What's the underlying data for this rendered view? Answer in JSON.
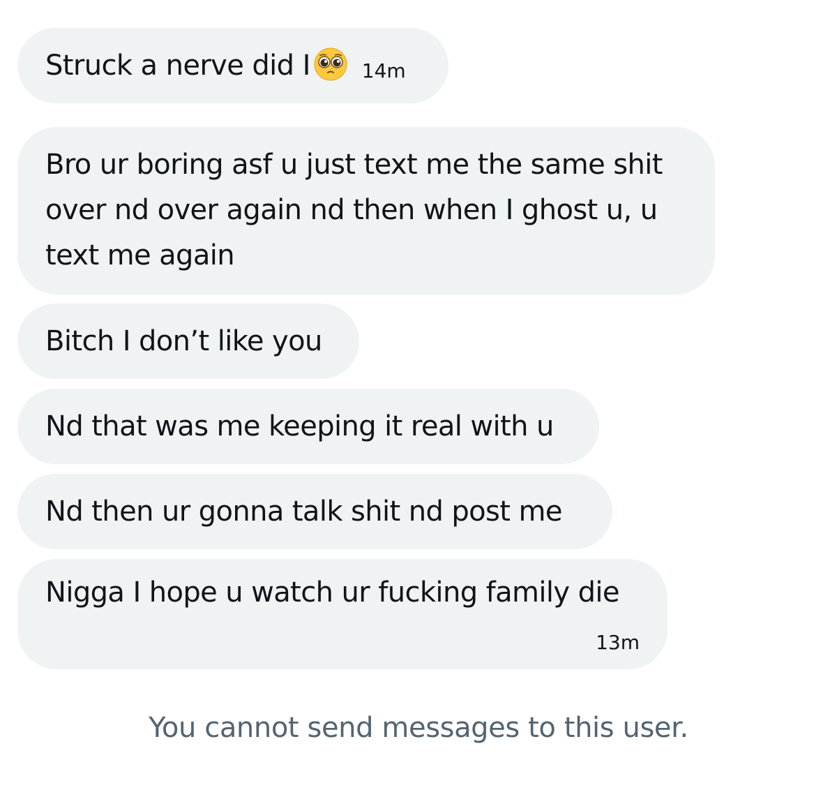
{
  "messages": [
    {
      "text": "Struck a nerve did I",
      "emoji": "pleading-face",
      "time": "14m"
    },
    {
      "text": "Bro ur boring asf u just text me the same shit over nd over again nd then when I ghost u, u text me again"
    },
    {
      "text": "Bitch I don’t like you"
    },
    {
      "text": "Nd that was me keeping it real with u"
    },
    {
      "text": "Nd then ur gonna talk shit nd post me"
    },
    {
      "text": "Nigga I hope u watch ur fucking family die",
      "time": "13m"
    }
  ],
  "notice": "You cannot send messages to this user.",
  "colors": {
    "bubble_bg": "#eff3f4",
    "text": "#0f1419",
    "notice": "#536471",
    "emoji_face": "#ffc83d"
  }
}
